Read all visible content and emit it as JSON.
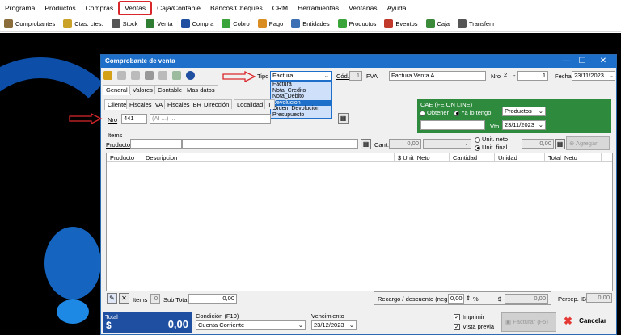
{
  "menubar": {
    "items": [
      "Programa",
      "Productos",
      "Compras",
      "Ventas",
      "Caja/Contable",
      "Bancos/Cheques",
      "CRM",
      "Herramientas",
      "Ventanas",
      "Ayuda"
    ]
  },
  "toolbar": {
    "items": [
      {
        "label": "Comprobantes",
        "icon": "document-stack-icon",
        "color": "#8a6d3b"
      },
      {
        "label": "Ctas. ctes.",
        "icon": "folders-icon",
        "color": "#c9a227"
      },
      {
        "label": "Stock",
        "icon": "boxes-icon",
        "color": "#555555"
      },
      {
        "label": "Venta",
        "icon": "pen-icon",
        "color": "#2f7d32"
      },
      {
        "label": "Compra",
        "icon": "cart-icon",
        "color": "#1f4fa0"
      },
      {
        "label": "Cobro",
        "icon": "money-in-icon",
        "color": "#3aa33a"
      },
      {
        "label": "Pago",
        "icon": "money-out-icon",
        "color": "#d98c1f"
      },
      {
        "label": "Entidades",
        "icon": "contacts-icon",
        "color": "#3d6fb5"
      },
      {
        "label": "Productos",
        "icon": "products-icon",
        "color": "#3aa33a"
      },
      {
        "label": "Eventos",
        "icon": "calendar-icon",
        "color": "#c0392b"
      },
      {
        "label": "Caja",
        "icon": "cash-icon",
        "color": "#3a8a3a"
      },
      {
        "label": "Transferir",
        "icon": "transfer-icon",
        "color": "#555555"
      }
    ]
  },
  "window": {
    "title": "Comprobante de venta",
    "controls": {
      "minimize": "—",
      "maximize": "☐",
      "close": "✕"
    }
  },
  "header": {
    "tipo_label": "Tipo",
    "tipo_value": "Factura",
    "cod_label": "Cód.",
    "cod_value": "1",
    "cod_code": "FVA",
    "cod_name": "Factura Venta A",
    "nro_label": "Nro",
    "nro_pv": "2",
    "nro_num": "1",
    "fecha_label": "Fecha",
    "fecha_value": "23/11/2023"
  },
  "tipo_dropdown": {
    "options": [
      "Factura",
      "Nota_Credito",
      "Nota_Debito",
      "Devolucion",
      "Orden_Devolucion",
      "Presupuesto"
    ],
    "highlighted": "Devolucion"
  },
  "main_tabs": [
    "General",
    "Valores",
    "Contable",
    "Mas datos"
  ],
  "cliente_tabs": [
    "Cliente",
    "Fiscales IVA",
    "Fiscales IBR",
    "Dirección",
    "Localidad",
    "T"
  ],
  "cliente": {
    "nro_label": "Nro",
    "nro_value": "441",
    "name_value": "(AI ...) ..."
  },
  "cae": {
    "title": "CAE (FE ON LINE)",
    "obtener_label": "Obtener",
    "ya_tengo_label": "Ya lo tengo",
    "productos_value": "Productos",
    "vto_label": "Vto",
    "vto_value": "23/11/2023",
    "bg_color": "#2e8b3e"
  },
  "items": {
    "section_label": "Items",
    "producto_label": "Producto",
    "cant_label": "Cant.",
    "cant_value": "0,00",
    "unit_neto_label": "Unit. neto",
    "unit_final_label": "Unit. final",
    "price_value": "0,00",
    "agregar_label": "Agregar",
    "columns": [
      "Producto",
      "Descripcion",
      "$ Unit_Neto",
      "Cantidad",
      "Unidad",
      "Total_Neto"
    ]
  },
  "footer_bar": {
    "items_label": "Items",
    "items_value": "0",
    "subtotal_label": "Sub Total",
    "subtotal_value": "0,00",
    "recargo_label": "Recargo / descuento (neg.)",
    "recargo_pct": "0,00",
    "pct_sign": "%",
    "dollar_sign": "$",
    "recargo_amount": "0,00",
    "percep_label": "Percep. IBR",
    "percep_value": "0,00"
  },
  "totals": {
    "total_label": "Total",
    "currency": "$",
    "total_value": "0,00",
    "condicion_label": "Condición (F10)",
    "condicion_value": "Cuenta Corriente",
    "vencimiento_label": "Vencimiento",
    "vencimiento_value": "23/12/2023",
    "imprimir_label": "Imprimir",
    "vista_previa_label": "Vista previa",
    "facturar_label": "Facturar (F5)",
    "cancelar_label": "Cancelar",
    "total_bg": "#1f4fa0"
  },
  "colors": {
    "accent": "#1e6fc9",
    "highlight_border": "#d9262a"
  }
}
